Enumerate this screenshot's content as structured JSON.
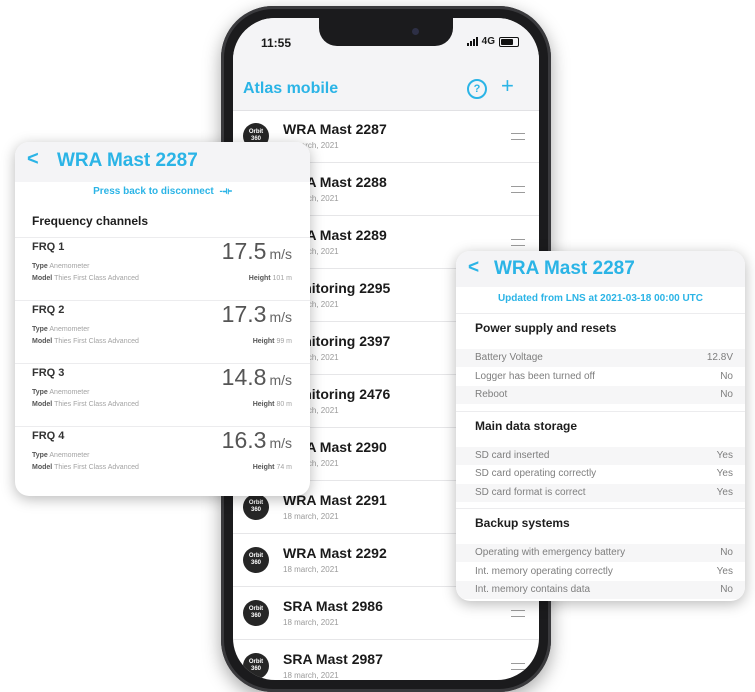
{
  "colors": {
    "accent": "#2bb4e6",
    "phone_frame": "#1b1b1d",
    "logo_bg": "#262626"
  },
  "phone": {
    "status": {
      "time": "11:55",
      "network": "4G"
    },
    "app_title": "Atlas mobile",
    "help_icon": "?",
    "add_icon": "+",
    "logo_text": [
      "Orbit",
      "360"
    ],
    "stations": [
      {
        "name": "WRA Mast 2287",
        "date": "18 march, 2021"
      },
      {
        "name": "WRA Mast 2288",
        "date": "18 march, 2021"
      },
      {
        "name": "WRA Mast 2289",
        "date": "18 march, 2021"
      },
      {
        "name": "Monitoring 2295",
        "date": "18 march, 2021"
      },
      {
        "name": "Monitoring 2397",
        "date": "18 march, 2021"
      },
      {
        "name": "Monitoring 2476",
        "date": "18 march, 2021"
      },
      {
        "name": "WRA Mast 2290",
        "date": "18 march, 2021"
      },
      {
        "name": "WRA Mast 2291",
        "date": "18 march, 2021"
      },
      {
        "name": "WRA Mast 2292",
        "date": "18 march, 2021"
      },
      {
        "name": "SRA Mast 2986",
        "date": "18 march, 2021"
      },
      {
        "name": "SRA Mast 2987",
        "date": "18 march, 2021"
      }
    ]
  },
  "left_card": {
    "title": "WRA Mast 2287",
    "disconnect_text": "Press back to disconnect",
    "section": "Frequency channels",
    "type_label": "Type",
    "model_label": "Model",
    "height_label": "Height",
    "channels": [
      {
        "label": "FRQ 1",
        "value": "17.5",
        "unit": "m/s",
        "type": "Anemometer",
        "model": "Thies First Class Advanced",
        "height": "101 m"
      },
      {
        "label": "FRQ 2",
        "value": "17.3",
        "unit": "m/s",
        "type": "Anemometer",
        "model": "Thies First Class Advanced",
        "height": "99 m"
      },
      {
        "label": "FRQ 3",
        "value": "14.8",
        "unit": "m/s",
        "type": "Anemometer",
        "model": "Thies First Class Advanced",
        "height": "80 m"
      },
      {
        "label": "FRQ 4",
        "value": "16.3",
        "unit": "m/s",
        "type": "Anemometer",
        "model": "Thies First Class Advanced",
        "height": "74 m"
      }
    ]
  },
  "right_card": {
    "title": "WRA Mast 2287",
    "updated": "Updated from LNS at 2021-03-18 00:00 UTC",
    "groups": [
      {
        "title": "Power supply and resets",
        "items": [
          {
            "key": "Battery Voltage",
            "value": "12.8V"
          },
          {
            "key": "Logger has been turned off",
            "value": "No"
          },
          {
            "key": "Reboot",
            "value": "No"
          }
        ]
      },
      {
        "title": "Main data storage",
        "items": [
          {
            "key": "SD card inserted",
            "value": "Yes"
          },
          {
            "key": "SD card operating correctly",
            "value": "Yes"
          },
          {
            "key": "SD card format is correct",
            "value": "Yes"
          }
        ]
      },
      {
        "title": "Backup systems",
        "items": [
          {
            "key": "Operating with emergency battery",
            "value": "No"
          },
          {
            "key": "Int. memory operating correctly",
            "value": "Yes"
          },
          {
            "key": "Int. memory contains data",
            "value": "No"
          }
        ]
      }
    ]
  }
}
